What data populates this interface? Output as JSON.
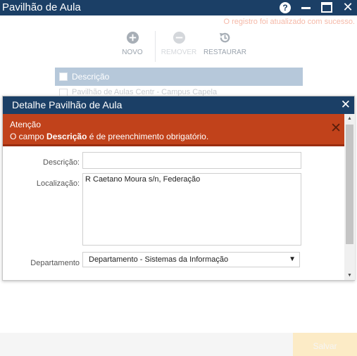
{
  "window": {
    "title": "Pavilhão de Aula",
    "help_glyph": "?",
    "close_glyph": "✕"
  },
  "status": {
    "message": "O registro foi atualizado com sucesso."
  },
  "toolbar": {
    "novo_label": "NOVO",
    "remover_label": "REMOVER",
    "restaurar_label": "RESTAURAR"
  },
  "grid": {
    "column_header": "Descrição",
    "rows": [
      {
        "descricao": "Pavilhão de Aulas Centr - Campus Capela"
      }
    ]
  },
  "footer": {
    "save_label": "Salvar"
  },
  "dialog": {
    "title": "Detalhe Pavilhão de Aula",
    "close_glyph": "✕",
    "alert": {
      "title": "Atenção",
      "message_prefix": "O campo ",
      "message_field": "Descrição",
      "message_suffix": " é de preenchimento obrigatório.",
      "close_glyph": "✕"
    },
    "form": {
      "descricao_label": "Descrição:",
      "descricao_value": "",
      "localizacao_label": "Localização:",
      "localizacao_value": "R Caetano Moura s/n, Federação",
      "departamento_label": "Departamento",
      "departamento_value": "Departamento - Sistemas da Informação"
    }
  },
  "colors": {
    "titlebar": "#1b3f66",
    "alert": "#c1421b",
    "status_text": "#f5b9a8",
    "save_button": "#fcebc6"
  }
}
